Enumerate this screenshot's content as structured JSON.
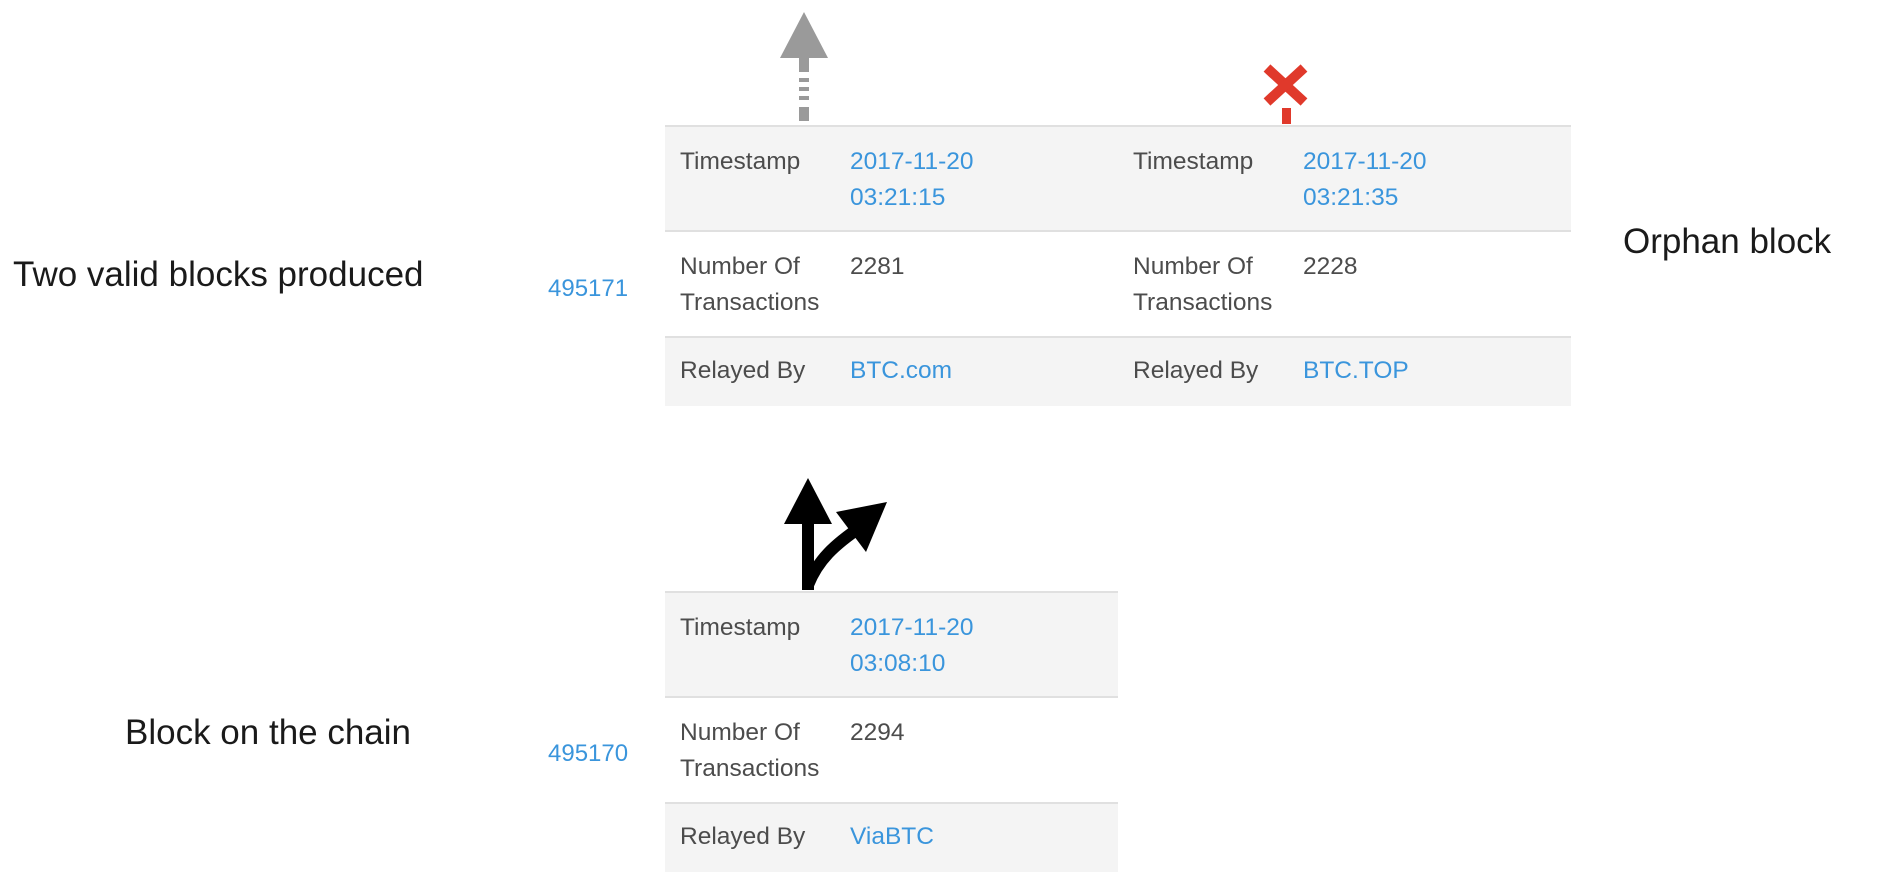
{
  "captions": {
    "two_valid_blocks": "Two valid blocks produced",
    "orphan_block": "Orphan block",
    "block_on_chain": "Block on the chain"
  },
  "heights": {
    "upper": "495171",
    "lower": "495170"
  },
  "upper_blocks": [
    {
      "timestamp_label": "Timestamp",
      "timestamp_date": "2017-11-20",
      "timestamp_time": "03:21:15",
      "tx_label_line1": "Number Of",
      "tx_label_line2": "Transactions",
      "tx_count": "2281",
      "relayed_label": "Relayed By",
      "relayed_by": "BTC.com"
    },
    {
      "timestamp_label": "Timestamp",
      "timestamp_date": "2017-11-20",
      "timestamp_time": "03:21:35",
      "tx_label_line1": "Number Of",
      "tx_label_line2": "Transactions",
      "tx_count": "2228",
      "relayed_label": "Relayed By",
      "relayed_by": "BTC.TOP"
    }
  ],
  "lower_block": {
    "timestamp_label": "Timestamp",
    "timestamp_date": "2017-11-20",
    "timestamp_time": "03:08:10",
    "tx_label_line1": "Number Of",
    "tx_label_line2": "Transactions",
    "tx_count": "2294",
    "relayed_label": "Relayed By",
    "relayed_by": "ViaBTC"
  },
  "icons": {
    "continue_arrow": "dashed-up-arrow-icon",
    "orphan_mark": "red-x-icon",
    "fork_arrow": "fork-arrow-icon"
  },
  "colors": {
    "link": "#3a95dc",
    "orphan_mark": "#e0392b",
    "dashed_arrow": "#9a9a9a",
    "fork_arrow": "#000000",
    "row_shade": "#f4f4f4"
  }
}
